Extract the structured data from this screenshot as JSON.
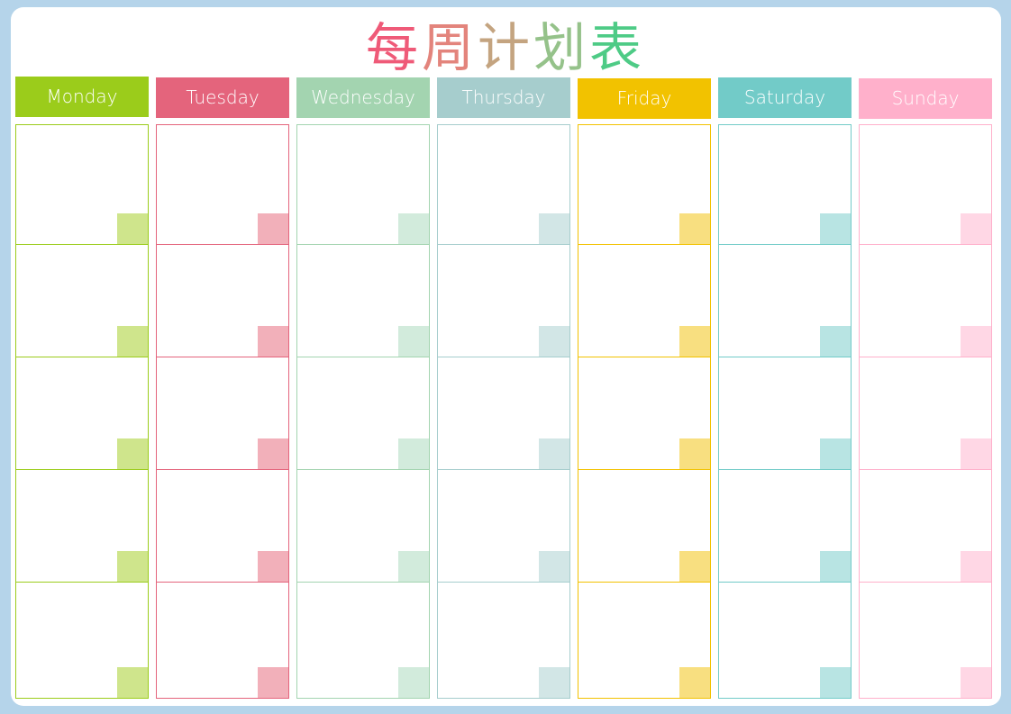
{
  "title": {
    "chars": [
      "每",
      "周",
      "计",
      "划",
      "表"
    ],
    "colors": [
      "#ef5a78",
      "#e3847c",
      "#c4a480",
      "#95c28a",
      "#4ecb86"
    ]
  },
  "days": [
    {
      "label": "Monday",
      "color": "#9bcc1b",
      "tag": "#cfe58c",
      "border": "#9bcc1b"
    },
    {
      "label": "Tuesday",
      "color": "#e4647c",
      "tag": "#f2b0ba",
      "border": "#e4647c"
    },
    {
      "label": "Wednesday",
      "color": "#a3d4b0",
      "tag": "#d2ebdc",
      "border": "#a3d4b0"
    },
    {
      "label": "Thursday",
      "color": "#a6cdcd",
      "tag": "#d2e6e6",
      "border": "#a6cdcd"
    },
    {
      "label": "Friday",
      "color": "#f2c200",
      "tag": "#f8df80",
      "border": "#f2c200"
    },
    {
      "label": "Saturday",
      "color": "#72cbc8",
      "tag": "#b8e4e3",
      "border": "#72cbc8"
    },
    {
      "label": "Sunday",
      "color": "#ffb0cb",
      "tag": "#ffd7e5",
      "border": "#ffb0cb"
    }
  ],
  "rows_per_day": 5,
  "frame_color": "#b5d4ea"
}
